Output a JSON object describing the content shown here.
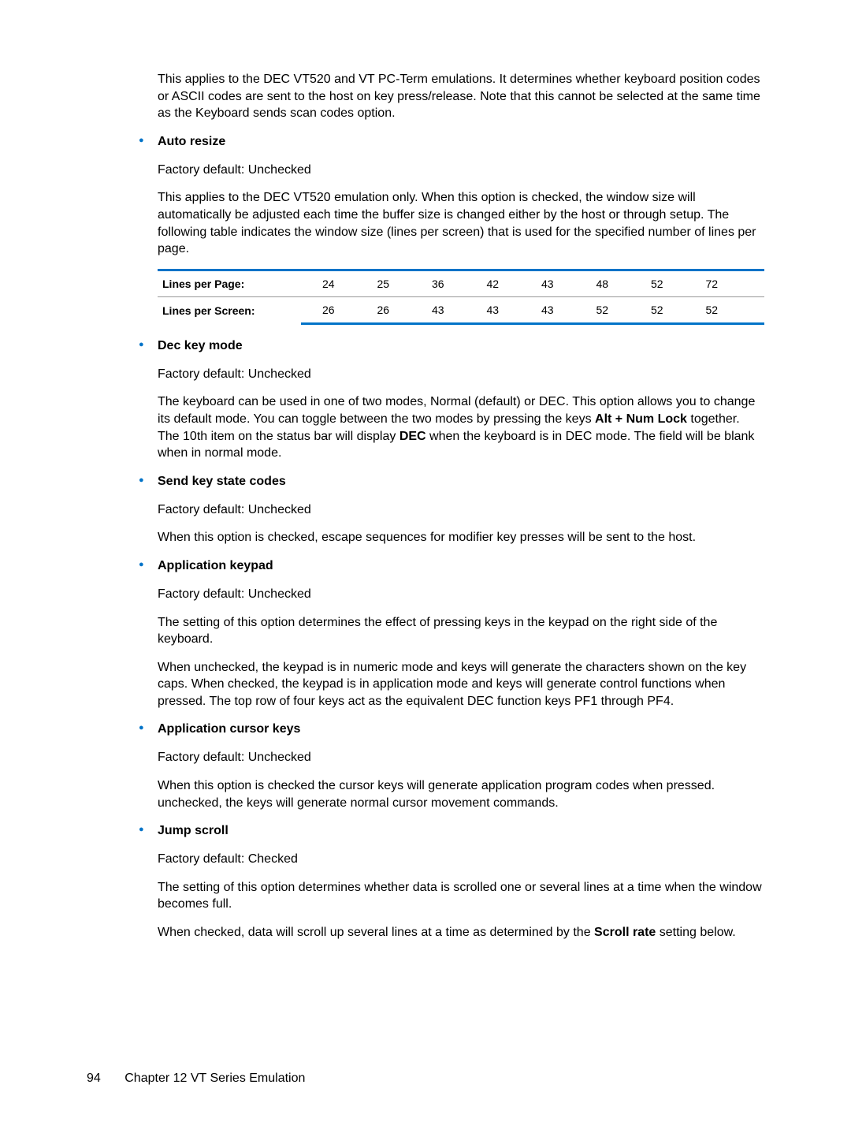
{
  "intro_p1": "This applies to the DEC VT520 and VT PC-Term emulations. It determines whether keyboard position codes or ASCII codes are sent to the host on key press/release. Note that this cannot be selected at the same time as the Keyboard sends scan codes option.",
  "sec_auto_resize": {
    "title": "Auto resize",
    "factory": "Factory default: Unchecked",
    "p1": "This applies to the DEC VT520 emulation only. When this option is checked, the window size will automatically be adjusted each time the buffer size is changed either by the host or through setup. The following table indicates the window size (lines per screen) that is used for the specified number of lines per page."
  },
  "chart_data": {
    "type": "table",
    "rows": [
      {
        "label": "Lines per Page:",
        "values": [
          "24",
          "25",
          "36",
          "42",
          "43",
          "48",
          "52",
          "72"
        ]
      },
      {
        "label": "Lines per Screen:",
        "values": [
          "26",
          "26",
          "43",
          "43",
          "43",
          "52",
          "52",
          "52"
        ]
      }
    ]
  },
  "sec_dec_key": {
    "title": "Dec key mode",
    "factory": "Factory default: Unchecked",
    "p1_a": "The keyboard can be used in one of two modes, Normal (default) or DEC. This option allows you to change its default mode. You can toggle between the two modes by pressing the keys ",
    "p1_b": "Alt + Num Lock",
    "p1_c": " together. The 10th item on the status bar will display ",
    "p1_d": "DEC",
    "p1_e": " when the keyboard is in DEC mode. The field will be blank when in normal mode."
  },
  "sec_send_key": {
    "title": "Send key state codes",
    "factory": "Factory default: Unchecked",
    "p1": "When this option is checked, escape sequences for modifier key presses will be sent to the host."
  },
  "sec_app_keypad": {
    "title": "Application keypad",
    "factory": "Factory default: Unchecked",
    "p1": "The setting of this option determines the effect of pressing keys in the keypad on the right side of the keyboard.",
    "p2": "When unchecked, the keypad is in numeric mode and keys will generate the characters shown on the key caps. When checked, the keypad is in application mode and keys will generate control functions when pressed. The top row of four keys act as the equivalent DEC function keys PF1 through PF4."
  },
  "sec_app_cursor": {
    "title": "Application cursor keys",
    "factory": "Factory default: Unchecked",
    "p1": "When this option is checked the cursor keys will generate application program codes when pressed. unchecked, the keys will generate normal cursor movement commands."
  },
  "sec_jump_scroll": {
    "title": "Jump scroll",
    "factory": "Factory default: Checked",
    "p1": "The setting of this option determines whether data is scrolled one or several lines at a time when the window becomes full.",
    "p2_a": "When checked, data will scroll up several lines at a time as determined by the ",
    "p2_b": "Scroll rate",
    "p2_c": " setting below."
  },
  "footer": {
    "page": "94",
    "chapter": "Chapter 12   VT Series Emulation"
  }
}
